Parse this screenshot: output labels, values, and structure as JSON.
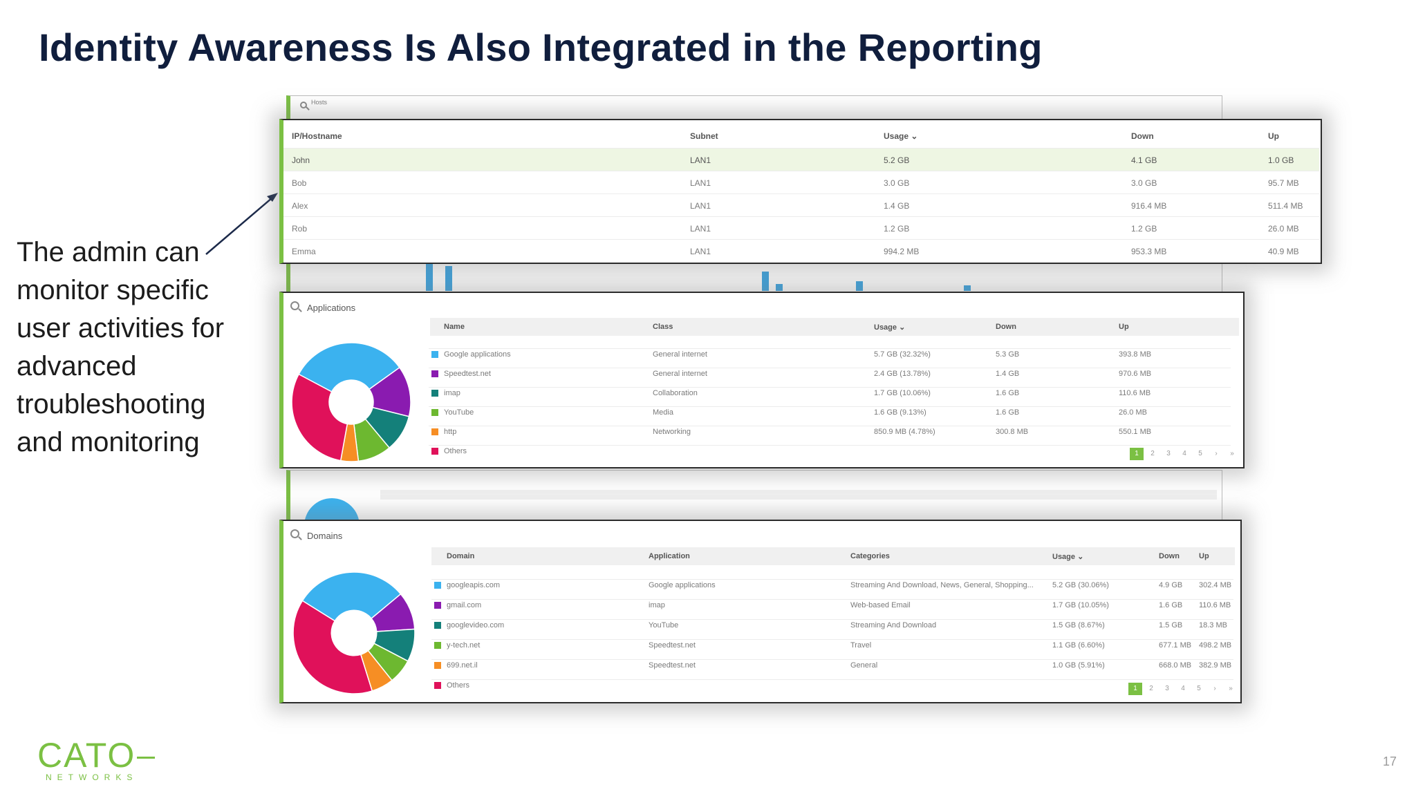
{
  "slide": {
    "title": "Identity Awareness Is Also Integrated in the Reporting",
    "callout": "The admin can monitor specific user activities for advanced troubleshooting and monitoring",
    "page_number": "17",
    "logo": {
      "main": "CATO",
      "sub": "NETWORKS"
    }
  },
  "colors": {
    "accent": "#7bc043",
    "title": "#101e3d",
    "google": "#3bb2ef",
    "speedtest": "#8a1bb0",
    "imap": "#14807a",
    "youtube": "#6db830",
    "http": "#f68e24",
    "others": "#e0115a"
  },
  "hosts": {
    "title": "Hosts",
    "columns": [
      "IP/Hostname",
      "Subnet",
      "Usage ⌄",
      "Down",
      "Up"
    ],
    "rows": [
      [
        "John",
        "LAN1",
        "5.2 GB",
        "4.1 GB",
        "1.0 GB"
      ],
      [
        "Bob",
        "LAN1",
        "3.0 GB",
        "3.0 GB",
        "95.7 MB"
      ],
      [
        "Alex",
        "LAN1",
        "1.4 GB",
        "916.4 MB",
        "511.4 MB"
      ],
      [
        "Rob",
        "LAN1",
        "1.2 GB",
        "1.2 GB",
        "26.0 MB"
      ],
      [
        "Emma",
        "LAN1",
        "994.2 MB",
        "953.3 MB",
        "40.9 MB"
      ]
    ]
  },
  "applications": {
    "title": "Applications",
    "columns": [
      "Name",
      "Class",
      "Usage ⌄",
      "Down",
      "Up"
    ],
    "rows": [
      [
        "Google applications",
        "General internet",
        "5.7 GB (32.32%)",
        "5.3 GB",
        "393.8 MB"
      ],
      [
        "Speedtest.net",
        "General internet",
        "2.4 GB (13.78%)",
        "1.4 GB",
        "970.6 MB"
      ],
      [
        "imap",
        "Collaboration",
        "1.7 GB (10.06%)",
        "1.6 GB",
        "110.6 MB"
      ],
      [
        "YouTube",
        "Media",
        "1.6 GB (9.13%)",
        "1.6 GB",
        "26.0 MB"
      ],
      [
        "http",
        "Networking",
        "850.9 MB (4.78%)",
        "300.8 MB",
        "550.1 MB"
      ],
      [
        "Others",
        "",
        "",
        "",
        ""
      ]
    ],
    "pages": [
      "1",
      "2",
      "3",
      "4",
      "5",
      "›",
      "»"
    ]
  },
  "domains": {
    "title": "Domains",
    "columns": [
      "Domain",
      "Application",
      "Categories",
      "Usage ⌄",
      "Down",
      "Up"
    ],
    "rows": [
      [
        "googleapis.com",
        "Google applications",
        "Streaming And Download, News, General, Shopping...",
        "5.2 GB (30.06%)",
        "4.9 GB",
        "302.4 MB"
      ],
      [
        "gmail.com",
        "imap",
        "Web-based Email",
        "1.7 GB (10.05%)",
        "1.6 GB",
        "110.6 MB"
      ],
      [
        "googlevideo.com",
        "YouTube",
        "Streaming And Download",
        "1.5 GB (8.67%)",
        "1.5 GB",
        "18.3 MB"
      ],
      [
        "y-tech.net",
        "Speedtest.net",
        "Travel",
        "1.1 GB (6.60%)",
        "677.1 MB",
        "498.2 MB"
      ],
      [
        "699.net.il",
        "Speedtest.net",
        "General",
        "1.0 GB (5.91%)",
        "668.0 MB",
        "382.9 MB"
      ],
      [
        "Others",
        "",
        "",
        "",
        "",
        ""
      ]
    ],
    "pages": [
      "1",
      "2",
      "3",
      "4",
      "5",
      "›",
      "»"
    ]
  },
  "chart_data": [
    {
      "type": "pie",
      "title": "Applications",
      "categories": [
        "Google applications",
        "Speedtest.net",
        "imap",
        "YouTube",
        "http",
        "Others"
      ],
      "values": [
        32.32,
        13.78,
        10.06,
        9.13,
        4.78,
        29.93
      ]
    },
    {
      "type": "pie",
      "title": "Domains",
      "categories": [
        "googleapis.com",
        "gmail.com",
        "googlevideo.com",
        "y-tech.net",
        "699.net.il",
        "Others"
      ],
      "values": [
        30.06,
        10.05,
        8.67,
        6.6,
        5.91,
        38.71
      ]
    }
  ]
}
